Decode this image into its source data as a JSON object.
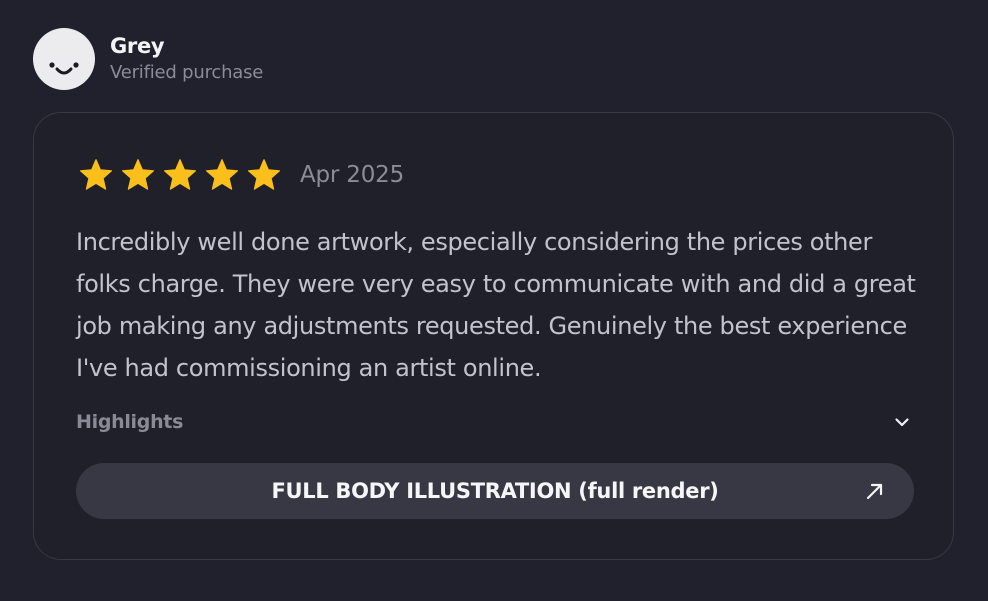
{
  "reviewer": {
    "name": "Grey",
    "status": "Verified purchase",
    "avatar_icon": "smiley-face-icon"
  },
  "review": {
    "rating": 5,
    "rating_max": 5,
    "date": "Apr 2025",
    "body": "Incredibly well done artwork, especially considering the prices other folks charge. They were very easy to communicate with and did a great job making any adjustments requested. Genuinely the best experience I've had commissioning an artist online.",
    "highlights_label": "Highlights",
    "highlights_icon": "chevron-down-icon",
    "product_label": "FULL BODY ILLUSTRATION (full render)",
    "product_icon": "arrow-up-right-icon"
  },
  "colors": {
    "background": "#21212d",
    "star": "#fbbf1c",
    "pill": "#383844",
    "muted_text": "#8c8c99"
  }
}
